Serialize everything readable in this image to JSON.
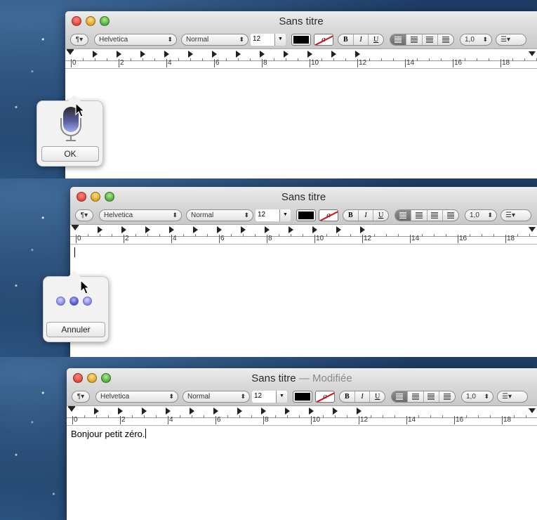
{
  "window": {
    "title": "Sans titre",
    "modified_separator": "—",
    "modified_label": "Modifiée"
  },
  "toolbar": {
    "paragraph_label": "¶▾",
    "font_family": "Helvetica",
    "font_style": "Normal",
    "font_size": "12",
    "text_color_icon": "black-swatch",
    "highlight_glyph": "a",
    "bold": "B",
    "italic": "I",
    "underline": "U",
    "line_spacing": "1,0",
    "list_label": "☰▾"
  },
  "ruler": {
    "labels": [
      "0",
      "2",
      "4",
      "6",
      "8",
      "10",
      "12",
      "14",
      "16",
      "18"
    ]
  },
  "dictation": {
    "ok_label": "OK",
    "cancel_label": "Annuler"
  },
  "document": {
    "text": "Bonjour petit zéro."
  },
  "colors": {
    "text_color": "#000000",
    "highlight_slash": "#d01010",
    "dictation_dots": "#8f93e6"
  }
}
